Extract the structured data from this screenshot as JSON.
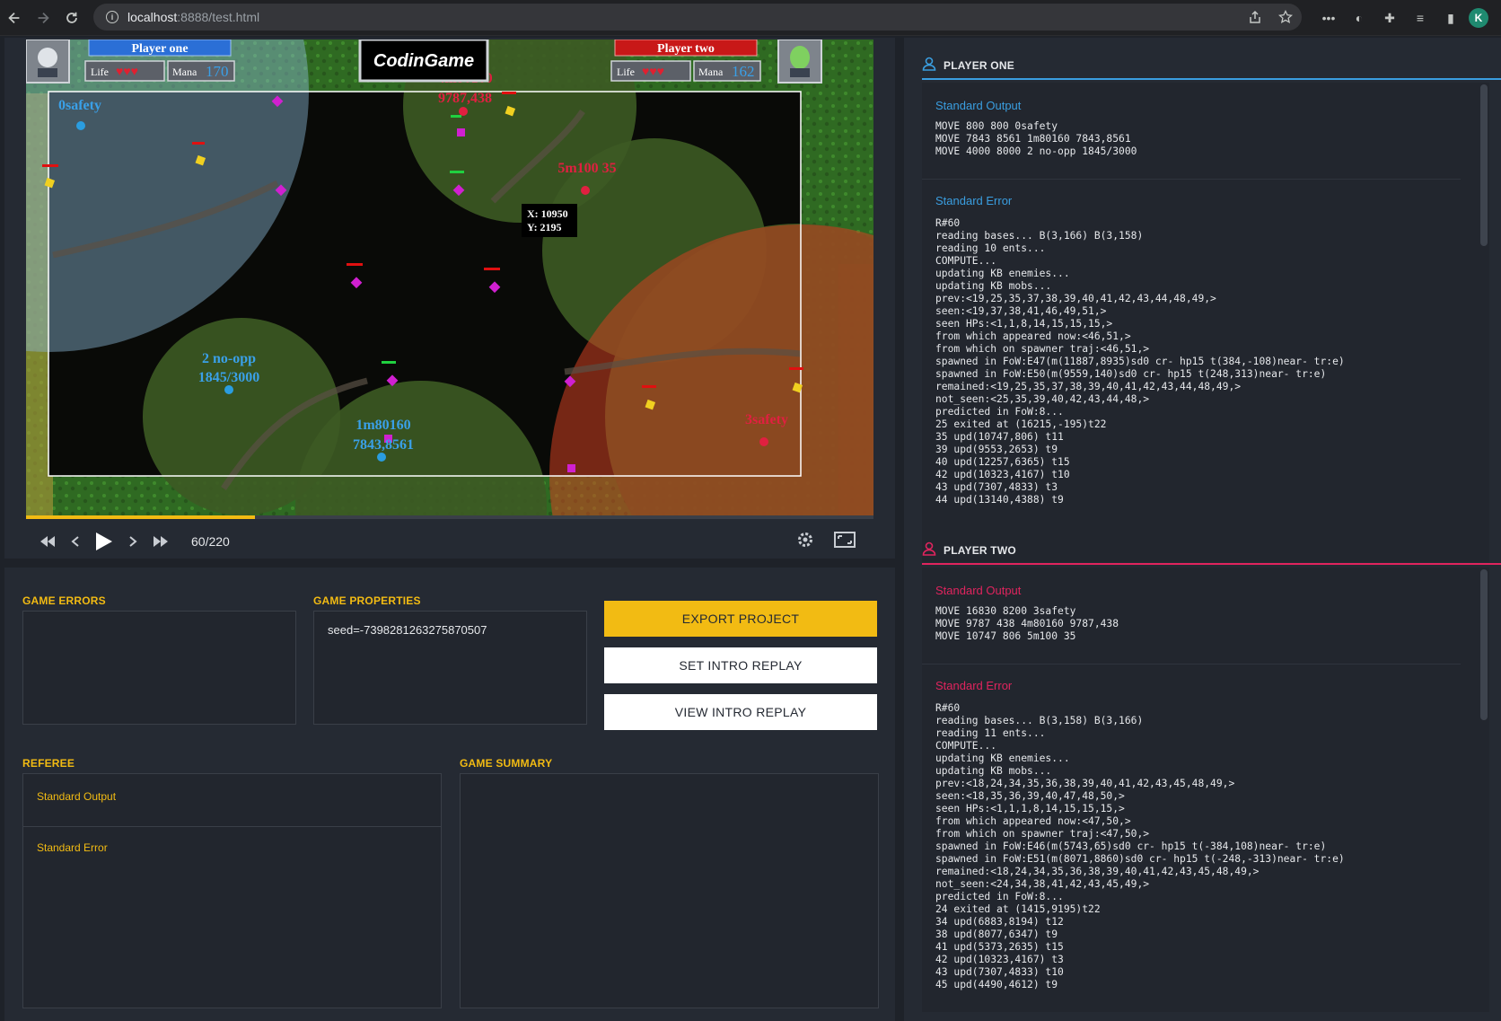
{
  "browser": {
    "url_host": "localhost",
    "url_rest": ":8888/test.html",
    "profile_initial": "K"
  },
  "game": {
    "player_one_name": "Player one",
    "player_two_name": "Player two",
    "life_label": "Life",
    "mana_label": "Mana",
    "player_one_mana": "170",
    "player_two_mana": "162",
    "logo": "CodinGame",
    "tooltip_x": "X: 10950",
    "tooltip_y": "Y: 2195",
    "labels": {
      "p1_base": "0safety",
      "p1_hero2_a": "2 no-opp",
      "p1_hero2_b": "1845/3000",
      "p1_hero1_a": "1m80160",
      "p1_hero1_b": "7843,8561",
      "p2_hero1_a": "4m80160",
      "p2_hero1_b": "9787,438",
      "p2_hero2": "5m100 35",
      "p2_base": "3safety"
    }
  },
  "player": {
    "frame": "60/220",
    "progress": 0.27
  },
  "bottom": {
    "game_errors_title": "GAME ERRORS",
    "game_properties_title": "GAME PROPERTIES",
    "properties_text": "seed=-7398281263275870507",
    "export_button": "EXPORT PROJECT",
    "set_intro_button": "SET INTRO REPLAY",
    "view_intro_button": "VIEW INTRO REPLAY",
    "referee_title": "REFEREE",
    "referee_stdout": "Standard Output",
    "referee_stderr": "Standard Error",
    "game_summary_title": "GAME SUMMARY"
  },
  "player_one": {
    "title": "PLAYER ONE",
    "stdout_title": "Standard Output",
    "stdout": "MOVE 800 800 0safety\nMOVE 7843 8561 1m80160 7843,8561\nMOVE 4000 8000 2 no-opp 1845/3000",
    "stderr_title": "Standard Error",
    "stderr": "R#60\nreading bases... B(3,166) B(3,158)\nreading 10 ents...\nCOMPUTE...\nupdating KB enemies...\nupdating KB mobs...\nprev:<19,25,35,37,38,39,40,41,42,43,44,48,49,>\nseen:<19,37,38,41,46,49,51,>\nseen HPs:<1,1,8,14,15,15,15,>\nfrom which appeared now:<46,51,>\nfrom which on spawner traj:<46,51,>\nspawned in FoW:E47(m(11887,8935)sd0 cr- hp15 t(384,-108)near- tr:e)\nspawned in FoW:E50(m(9559,140)sd0 cr- hp15 t(248,313)near- tr:e)\nremained:<19,25,35,37,38,39,40,41,42,43,44,48,49,>\nnot_seen:<25,35,39,40,42,43,44,48,>\npredicted in FoW:8...\n25 exited at (16215,-195)t22\n35 upd(10747,806) t11\n39 upd(9553,2653) t9\n40 upd(12257,6365) t15\n42 upd(10323,4167) t10\n43 upd(7307,4833) t3\n44 upd(13140,4388) t9"
  },
  "player_two": {
    "title": "PLAYER TWO",
    "stdout_title": "Standard Output",
    "stdout": "MOVE 16830 8200 3safety\nMOVE 9787 438 4m80160 9787,438\nMOVE 10747 806 5m100 35",
    "stderr_title": "Standard Error",
    "stderr": "R#60\nreading bases... B(3,158) B(3,166)\nreading 11 ents...\nCOMPUTE...\nupdating KB enemies...\nupdating KB mobs...\nprev:<18,24,34,35,36,38,39,40,41,42,43,45,48,49,>\nseen:<18,35,36,39,40,47,48,50,>\nseen HPs:<1,1,1,8,14,15,15,15,>\nfrom which appeared now:<47,50,>\nfrom which on spawner traj:<47,50,>\nspawned in FoW:E46(m(5743,65)sd0 cr- hp15 t(-384,108)near- tr:e)\nspawned in FoW:E51(m(8071,8860)sd0 cr- hp15 t(-248,-313)near- tr:e)\nremained:<18,24,34,35,36,38,39,40,41,42,43,45,48,49,>\nnot_seen:<24,34,38,41,42,43,45,49,>\npredicted in FoW:8...\n24 exited at (1415,9195)t22\n34 upd(6883,8194) t12\n38 upd(8077,6347) t9\n41 upd(5373,2635) t15\n42 upd(10323,4167) t3\n43 upd(7307,4833) t10\n45 upd(4490,4612) t9"
  },
  "colors": {
    "accent": "#f2bb13",
    "player_one": "#3a9ee0",
    "player_two": "#e0245e"
  }
}
